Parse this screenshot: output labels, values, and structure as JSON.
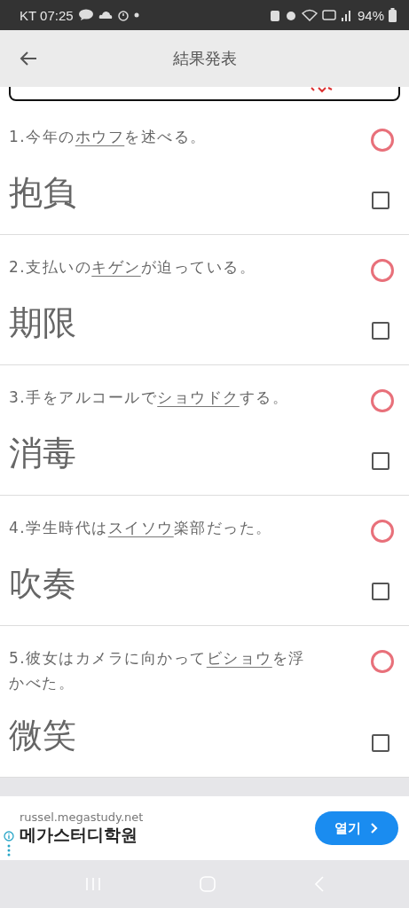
{
  "status_bar": {
    "carrier_time": "KT 07:25",
    "battery": "94%"
  },
  "app_bar": {
    "title": "結果発表"
  },
  "questions": [
    {
      "number": "1.",
      "before": "今年の",
      "underlined": "ホウフ",
      "after": "を述べる。",
      "answer": "抱負",
      "correct": true,
      "checked": false
    },
    {
      "number": "2.",
      "before": "支払いの",
      "underlined": "キゲン",
      "after": "が迫っている。",
      "answer": "期限",
      "correct": true,
      "checked": false
    },
    {
      "number": "3.",
      "before": "手をアルコールで",
      "underlined": "ショウドク",
      "after": "する。",
      "answer": "消毒",
      "correct": true,
      "checked": false
    },
    {
      "number": "4.",
      "before": "学生時代は",
      "underlined": "スイソウ",
      "after": "楽部だった。",
      "answer": "吹奏",
      "correct": true,
      "checked": false
    },
    {
      "number": "5.",
      "before": "彼女はカメラに向かって",
      "underlined": "ビショウ",
      "after": "を浮かべた。",
      "answer": "微笑",
      "correct": true,
      "checked": false
    }
  ],
  "ad": {
    "domain": "russel.megastudy.net",
    "title": "메가스터디학원",
    "button": "열기"
  }
}
